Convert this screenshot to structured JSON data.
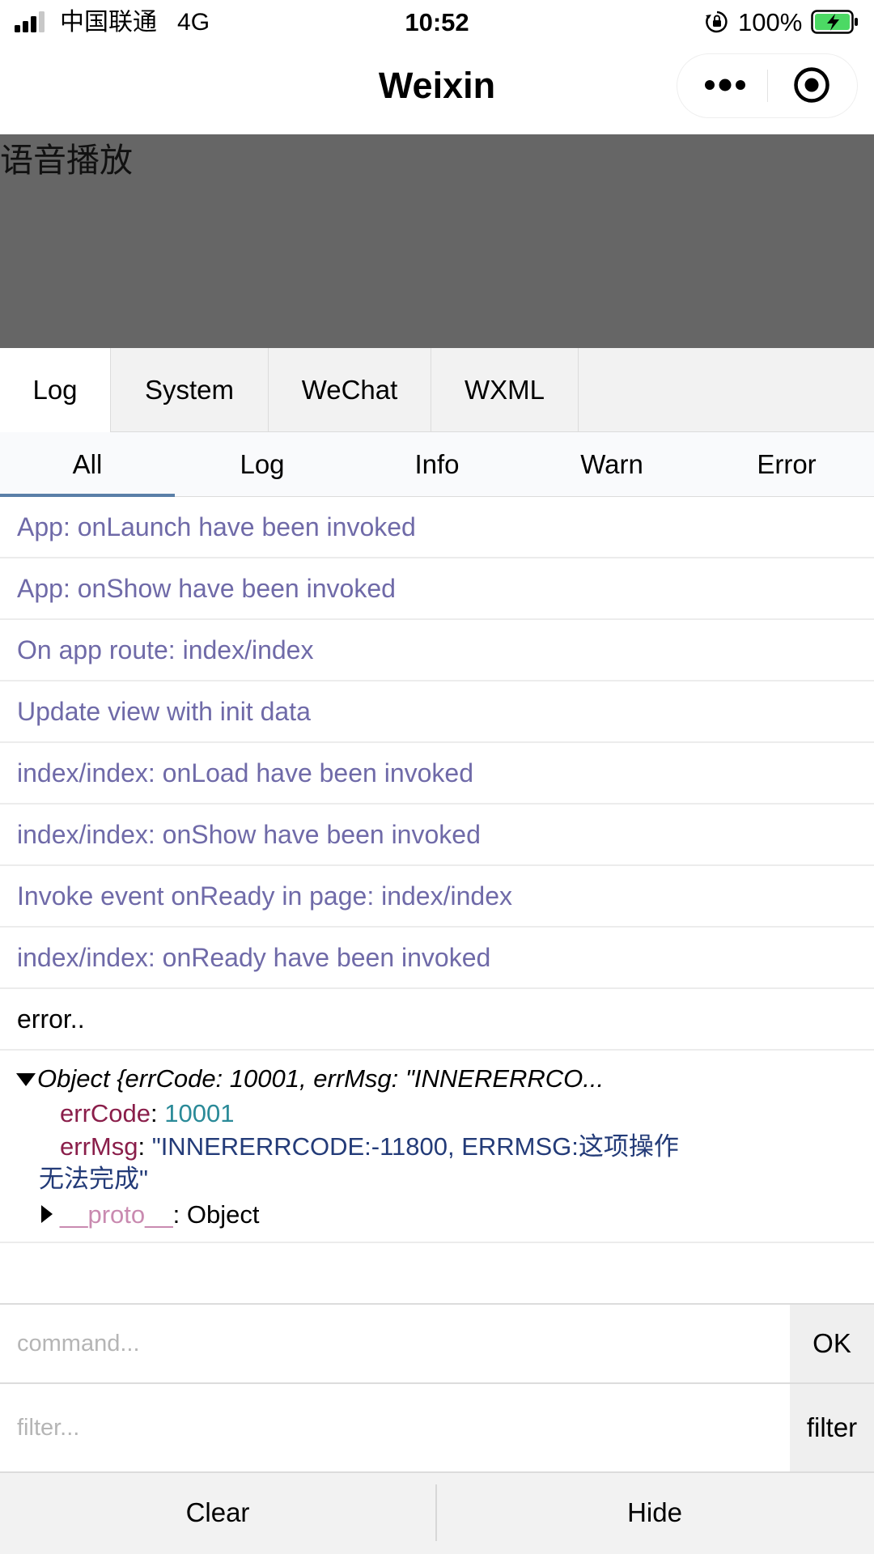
{
  "status_bar": {
    "carrier": "中国联通   4G",
    "time": "10:52",
    "battery_percent": "100%",
    "icons": [
      "signal-icon",
      "orientation-lock-icon",
      "battery-charging-icon"
    ],
    "battery_color": "#4cd964"
  },
  "nav": {
    "title": "Weixin",
    "icons": [
      "more-icon",
      "close-miniprogram-icon"
    ]
  },
  "page": {
    "label": "语音播放",
    "background": "#666666"
  },
  "console": {
    "tabs": [
      "Log",
      "System",
      "WeChat",
      "WXML"
    ],
    "active_tab": "Log",
    "filters": [
      "All",
      "Log",
      "Info",
      "Warn",
      "Error"
    ],
    "active_filter": "All",
    "logs": [
      "App: onLaunch have been invoked",
      "App: onShow have been invoked",
      "On app route: index/index",
      "Update view with init data",
      "index/index: onLoad have been invoked",
      "index/index: onShow have been invoked",
      "Invoke event onReady in page: index/index",
      "index/index: onReady have been invoked",
      "error.."
    ],
    "object": {
      "header": "Object {errCode: 10001, errMsg: \"INNERERRCO...",
      "errcode_key": "errCode",
      "errcode_value": "10001",
      "errmsg_key": "errMsg",
      "errmsg_value_line1": "\"INNERERRCODE:-11800, ERRMSG:这项操作",
      "errmsg_value_line2": "无法完成\"",
      "proto_key": "__proto__",
      "proto_value": ": Object"
    },
    "command": {
      "placeholder": "command...",
      "button": "OK"
    },
    "filter": {
      "placeholder": "filter...",
      "button": "filter"
    },
    "toolbar": {
      "clear": "Clear",
      "hide": "Hide"
    },
    "colors": {
      "log_text": "#6f6aa8",
      "indicator": "#5a7fa8",
      "key": "#8a1e4a",
      "number": "#2a8a98",
      "string": "#233b78"
    }
  }
}
